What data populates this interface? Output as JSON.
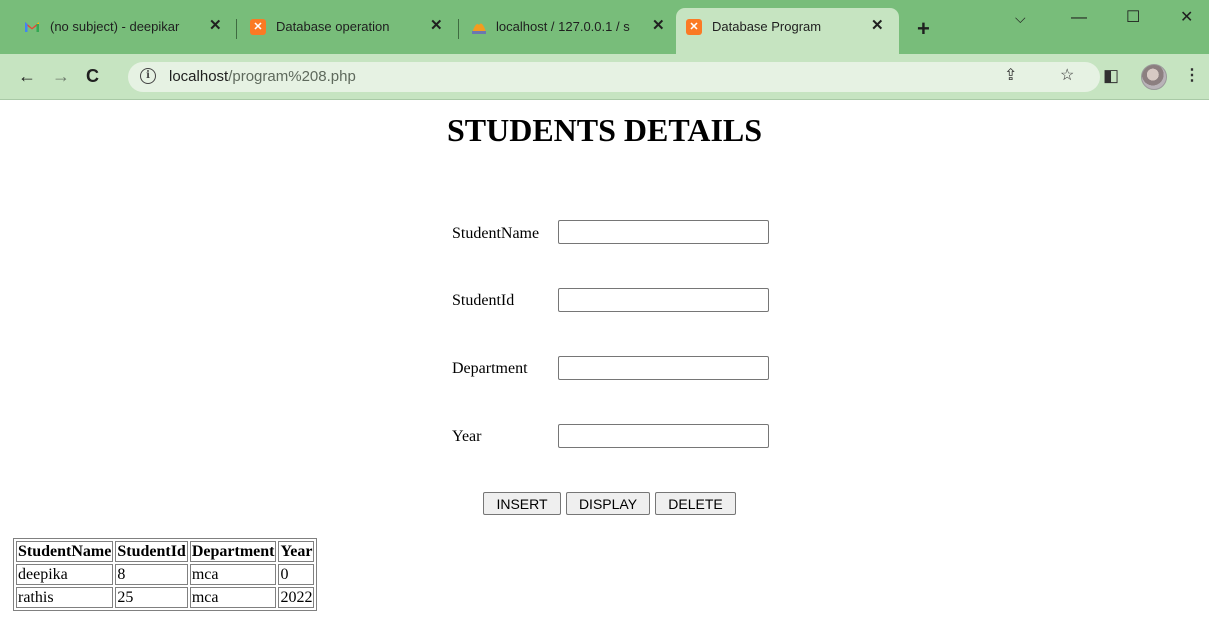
{
  "browser": {
    "tabs": [
      {
        "title": "(no subject) - deepikar",
        "favicon": "gmail-icon",
        "active": false
      },
      {
        "title": "Database operation",
        "favicon": "xampp-icon",
        "active": false
      },
      {
        "title": "localhost / 127.0.0.1 / s",
        "favicon": "phpmyadmin-icon",
        "active": false
      },
      {
        "title": "Database Program",
        "favicon": "xampp-icon",
        "active": true
      }
    ],
    "new_tab": "+",
    "url_host": "localhost",
    "url_path": "/program%208.php",
    "theme_color": "#78bd7a"
  },
  "page": {
    "title": "STUDENTS DETAILS",
    "form": {
      "fields": [
        {
          "label": "StudentName",
          "value": ""
        },
        {
          "label": "StudentId",
          "value": ""
        },
        {
          "label": "Department",
          "value": ""
        },
        {
          "label": "Year",
          "value": ""
        }
      ],
      "buttons": [
        "INSERT",
        "DISPLAY",
        "DELETE"
      ]
    },
    "table": {
      "headers": [
        "StudentName",
        "StudentId",
        "Department",
        "Year"
      ],
      "rows": [
        [
          "deepika",
          "8",
          "mca",
          "0"
        ],
        [
          "rathis",
          "25",
          "mca",
          "2022"
        ]
      ]
    }
  }
}
